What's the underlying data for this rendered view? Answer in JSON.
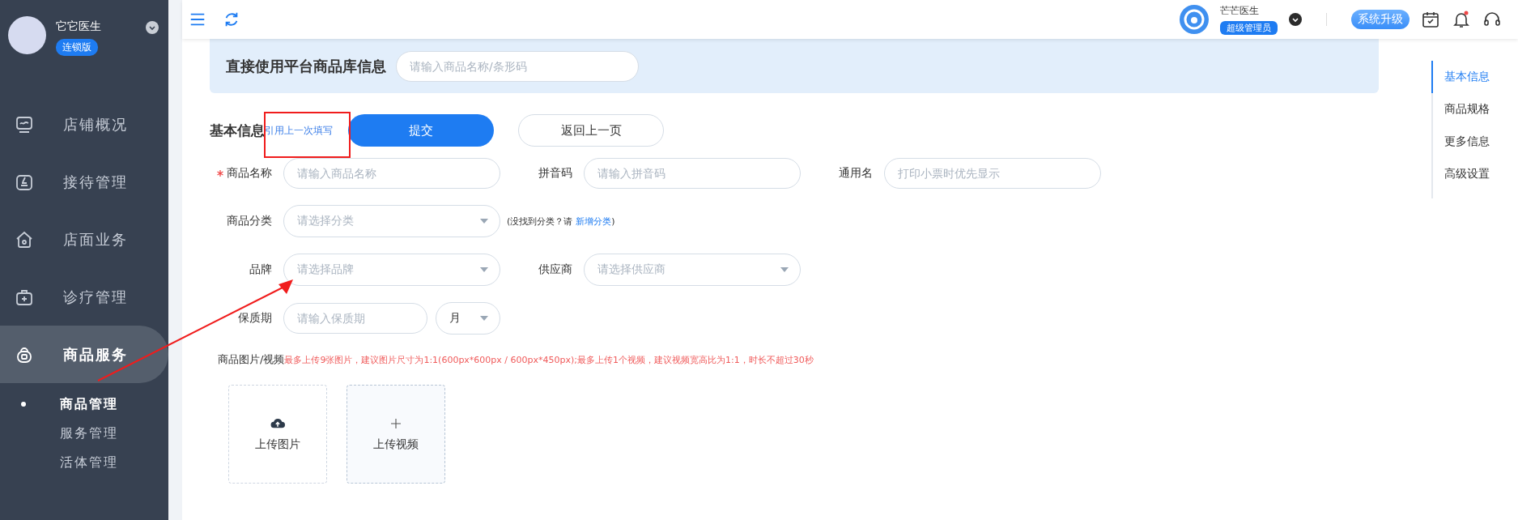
{
  "sidebar": {
    "org_name": "它它医生",
    "edition_badge": "连锁版",
    "menu": [
      {
        "label": "店铺概况",
        "selected": false
      },
      {
        "label": "接待管理",
        "selected": false
      },
      {
        "label": "店面业务",
        "selected": false
      },
      {
        "label": "诊疗管理",
        "selected": false
      },
      {
        "label": "商品服务",
        "selected": true,
        "expanded": true,
        "children": [
          {
            "label": "商品管理",
            "selected": true
          },
          {
            "label": "服务管理",
            "selected": false
          },
          {
            "label": "活体管理",
            "selected": false
          }
        ]
      }
    ]
  },
  "top_bar": {
    "user_name": "芒芒医生",
    "role_badge": "超级管理员",
    "upgrade_button": "系统升级",
    "notification_unread": true
  },
  "platform_lookup": {
    "title": "直接使用平台商品库信息",
    "placeholder": "请输入商品名称/条形码"
  },
  "form": {
    "section_title": "基本信息",
    "reuse_link": "引用上一次填写",
    "submit_button": "提交",
    "back_button": "返回上一页",
    "rows": [
      {
        "fields": [
          {
            "kind": "input",
            "label": "商品名称",
            "required": true,
            "placeholder": "请输入商品名称"
          },
          {
            "kind": "input",
            "label": "拼音码",
            "required": false,
            "placeholder": "请输入拼音码"
          },
          {
            "kind": "input",
            "label": "通用名",
            "required": false,
            "placeholder": "打印小票时优先显示"
          }
        ]
      },
      {
        "fields": [
          {
            "kind": "select",
            "label": "商品分类",
            "required": false,
            "placeholder": "请选择分类"
          }
        ],
        "hint": "(没找到分类？请",
        "hint_link": "新增分类",
        "hint_end": ")"
      },
      {
        "fields": [
          {
            "kind": "select",
            "label": "品牌",
            "required": false,
            "placeholder": "请选择品牌"
          },
          {
            "kind": "select",
            "label": "供应商",
            "required": false,
            "placeholder": "请选择供应商"
          }
        ]
      },
      {
        "fields": [
          {
            "kind": "input_unit",
            "label": "保质期",
            "required": false,
            "placeholder": "请输入保质期",
            "unit": "月"
          }
        ]
      }
    ],
    "media_label": "商品图片/视频",
    "media_note": "最多上传9张图片，建议图片尺寸为1:1(600px*600px / 600px*450px);最多上传1个视频，建议视频宽高比为1:1，时长不超过30秒",
    "uploads": [
      {
        "kind": "image",
        "label": "上传图片"
      },
      {
        "kind": "video",
        "label": "上传视频"
      }
    ]
  },
  "anchor_nav": [
    {
      "label": "基本信息",
      "selected": true
    },
    {
      "label": "商品规格",
      "selected": false
    },
    {
      "label": "更多信息",
      "selected": false
    },
    {
      "label": "高级设置",
      "selected": false
    }
  ]
}
